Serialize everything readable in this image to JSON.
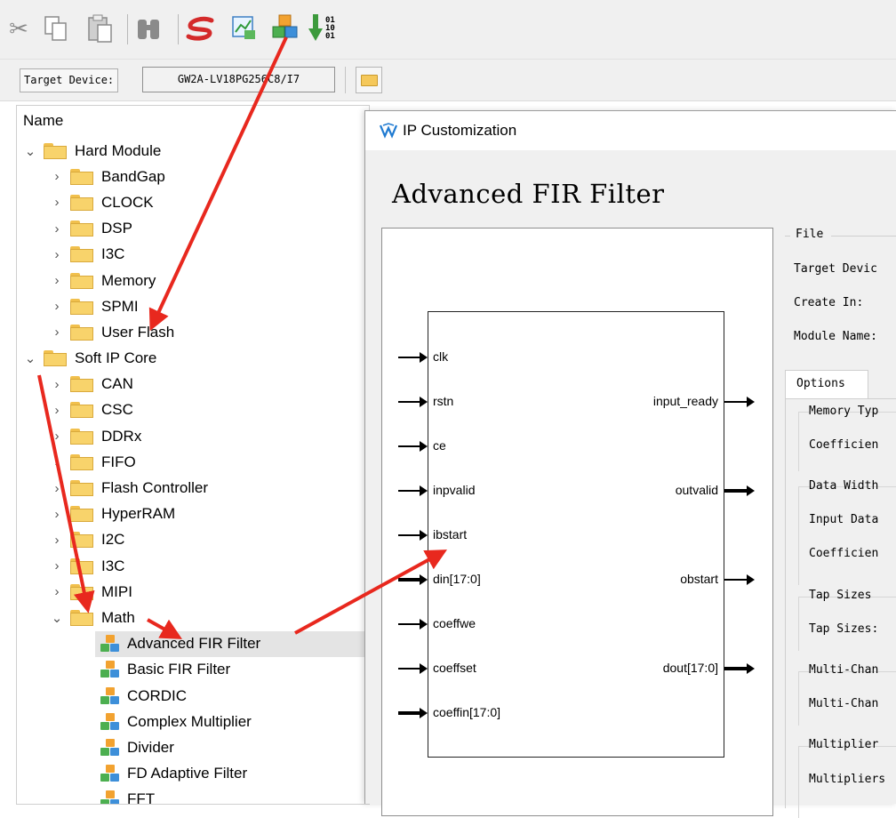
{
  "toolbar": {
    "icons": [
      "cut-icon",
      "copy-icon",
      "paste-icon",
      "find-icon",
      "synplify-icon",
      "report-icon",
      "ip-core-generator-icon",
      "program-device-icon"
    ]
  },
  "device_bar": {
    "label": "Target Device:",
    "value": "GW2A-LV18PG256C8/I7"
  },
  "tree": {
    "header": "Name",
    "rows": [
      {
        "label": "Hard Module",
        "level": 0,
        "expanded": true,
        "kind": "folder"
      },
      {
        "label": "BandGap",
        "level": 1,
        "expanded": false,
        "kind": "folder"
      },
      {
        "label": "CLOCK",
        "level": 1,
        "expanded": false,
        "kind": "folder"
      },
      {
        "label": "DSP",
        "level": 1,
        "expanded": false,
        "kind": "folder"
      },
      {
        "label": "I3C",
        "level": 1,
        "expanded": false,
        "kind": "folder"
      },
      {
        "label": "Memory",
        "level": 1,
        "expanded": false,
        "kind": "folder"
      },
      {
        "label": "SPMI",
        "level": 1,
        "expanded": false,
        "kind": "folder"
      },
      {
        "label": "User Flash",
        "level": 1,
        "expanded": false,
        "kind": "folder"
      },
      {
        "label": "Soft IP Core",
        "level": 0,
        "expanded": true,
        "kind": "folder"
      },
      {
        "label": "CAN",
        "level": 1,
        "expanded": false,
        "kind": "folder"
      },
      {
        "label": "CSC",
        "level": 1,
        "expanded": false,
        "kind": "folder"
      },
      {
        "label": "DDRx",
        "level": 1,
        "expanded": false,
        "kind": "folder"
      },
      {
        "label": "FIFO",
        "level": 1,
        "expanded": false,
        "kind": "folder"
      },
      {
        "label": "Flash Controller",
        "level": 1,
        "expanded": false,
        "kind": "folder"
      },
      {
        "label": "HyperRAM",
        "level": 1,
        "expanded": false,
        "kind": "folder"
      },
      {
        "label": "I2C",
        "level": 1,
        "expanded": false,
        "kind": "folder"
      },
      {
        "label": "I3C",
        "level": 1,
        "expanded": false,
        "kind": "folder"
      },
      {
        "label": "MIPI",
        "level": 1,
        "expanded": false,
        "kind": "folder"
      },
      {
        "label": "Math",
        "level": 1,
        "expanded": true,
        "kind": "folder"
      },
      {
        "label": "Advanced FIR Filter",
        "level": 2,
        "kind": "ip",
        "selected": true
      },
      {
        "label": "Basic FIR Filter",
        "level": 2,
        "kind": "ip"
      },
      {
        "label": "CORDIC",
        "level": 2,
        "kind": "ip"
      },
      {
        "label": "Complex Multiplier",
        "level": 2,
        "kind": "ip"
      },
      {
        "label": "Divider",
        "level": 2,
        "kind": "ip"
      },
      {
        "label": "FD Adaptive Filter",
        "level": 2,
        "kind": "ip"
      },
      {
        "label": "FFT",
        "level": 2,
        "kind": "ip"
      }
    ]
  },
  "dialog": {
    "title": "IP Customization",
    "ip_name": "Advanced FIR Filter",
    "inputs": [
      "clk",
      "rstn",
      "ce",
      "inpvalid",
      "ibstart",
      "din[17:0]",
      "coeffwe",
      "coeffset",
      "coeffin[17:0]"
    ],
    "outputs": [
      "input_ready",
      "outvalid",
      "obstart",
      "dout[17:0]"
    ],
    "panel": {
      "file_group": "File",
      "target_device": "Target Devic",
      "create_in": "Create In:",
      "module_name": "Module Name:",
      "options_tab": "Options",
      "memory_type": "Memory Typ",
      "coefficient_1": "Coefficien",
      "data_width": "Data Width",
      "input_data": "Input Data",
      "coefficient_2": "Coefficien",
      "tap_sizes_group": "Tap Sizes",
      "tap_sizes": "Tap Sizes:",
      "multi_channel_group": "Multi-Chan",
      "multi_channel": "Multi-Chan",
      "multiplier_group": "Multiplier",
      "multipliers": "Multipliers"
    }
  },
  "colors": {
    "annotation_arrow": "#e8281e",
    "folder": "#f8d36b",
    "selection": "#e4e4e4"
  }
}
